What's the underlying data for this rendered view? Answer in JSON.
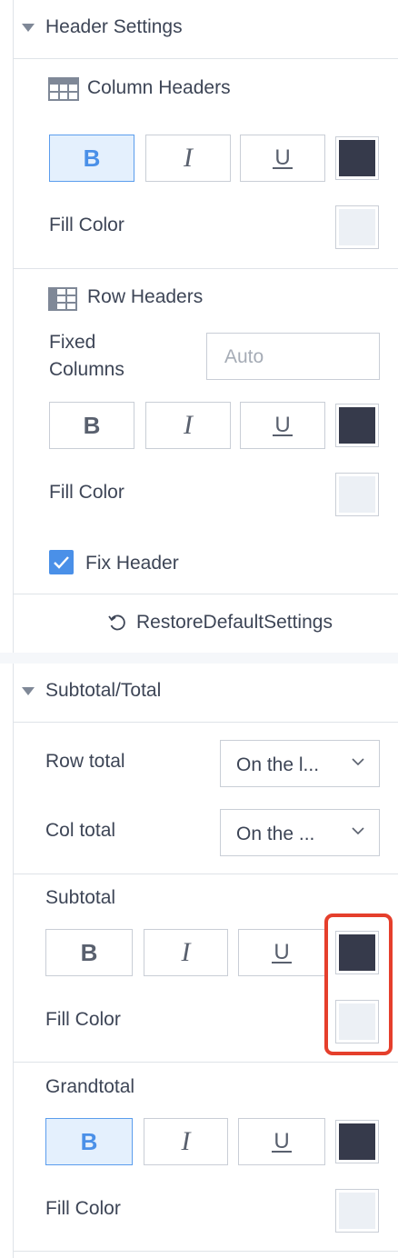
{
  "header_settings": {
    "section_title": "Header Settings",
    "column_headers": {
      "label": "Column Headers",
      "bold_label": "B",
      "italic_label": "I",
      "underline_label": "U",
      "bold_active": true,
      "font_color": "#363a4b",
      "fill_color_label": "Fill Color",
      "fill_color": "#ecf0f5"
    },
    "row_headers": {
      "label": "Row Headers",
      "fixed_columns_label_line1": "Fixed",
      "fixed_columns_label_line2": "Columns",
      "fixed_columns_placeholder": "Auto",
      "bold_label": "B",
      "italic_label": "I",
      "underline_label": "U",
      "font_color": "#363a4b",
      "fill_color_label": "Fill Color",
      "fill_color": "#ecf0f5"
    },
    "fix_header": {
      "label": "Fix Header",
      "checked": true
    },
    "restore_label": "RestoreDefaultSettings"
  },
  "subtotal_total": {
    "section_title": "Subtotal/Total",
    "row_total": {
      "label": "Row total",
      "value": "On the l..."
    },
    "col_total": {
      "label": "Col total",
      "value": "On the ..."
    },
    "subtotal": {
      "label": "Subtotal",
      "bold_label": "B",
      "italic_label": "I",
      "underline_label": "U",
      "font_color": "#363a4b",
      "fill_color_label": "Fill Color",
      "fill_color": "#ecf0f5"
    },
    "grandtotal": {
      "label": "Grandtotal",
      "bold_label": "B",
      "italic_label": "I",
      "underline_label": "U",
      "bold_active": true,
      "font_color": "#363a4b",
      "fill_color_label": "Fill Color",
      "fill_color": "#ecf0f5"
    }
  },
  "colors": {
    "accent": "#4a90e8",
    "highlight_border": "#e53f2c",
    "text": "#3d4556",
    "divider": "#dfe3e8"
  }
}
